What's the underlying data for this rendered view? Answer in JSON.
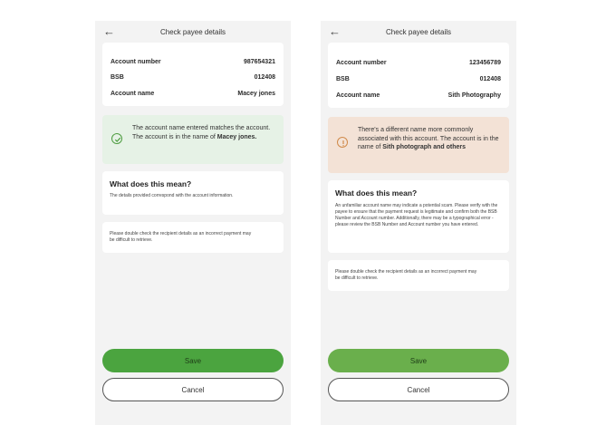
{
  "screens": [
    {
      "header": {
        "title": "Check payee details"
      },
      "details": [
        {
          "label": "Account number",
          "value": "987654321"
        },
        {
          "label": "BSB",
          "value": "012408"
        },
        {
          "label": "Account name",
          "value": "Macey jones"
        }
      ],
      "banner": {
        "type": "success",
        "text": "The account name entered matches the account. The account is in the name of ",
        "bold": "Macey jones."
      },
      "meaning": {
        "heading": "What does this mean?",
        "body": "The details provided correspond with the account information."
      },
      "notice": "Please double check the recipient details as an incorrect payment may be difficult to retrieve.",
      "save_label": "Save",
      "cancel_label": "Cancel"
    },
    {
      "header": {
        "title": "Check payee details"
      },
      "details": [
        {
          "label": "Account number",
          "value": "123456789"
        },
        {
          "label": "BSB",
          "value": "012408"
        },
        {
          "label": "Account name",
          "value": "Sith Photography"
        }
      ],
      "banner": {
        "type": "warning",
        "text": "There's a different name more commonly associated with this account. The account is in the name of ",
        "bold": "Sith photograph and others"
      },
      "meaning": {
        "heading": "What does this mean?",
        "body": "An unfamiliar account name may indicate a potential scam. Please verify with the payee to ensure that the payment request is legitimate and confirm both the BSB Number and Account number. Additionally, there may be a typographical error - please review the BSB Number and Account number you have entered."
      },
      "notice": "Please double check the recipient details as an incorrect payment may be difficult to retrieve.",
      "save_label": "Save",
      "cancel_label": "Cancel"
    }
  ],
  "colors": {
    "success_bg": "#e6f2e6",
    "success_icon": "#4c9c3f",
    "warning_bg": "#f3e2d6",
    "warning_icon": "#d08a4a",
    "save_button": "#4ba43f"
  },
  "icons": {
    "back": "back-arrow-icon",
    "success": "check-circle-icon",
    "warning": "exclamation-circle-icon"
  }
}
